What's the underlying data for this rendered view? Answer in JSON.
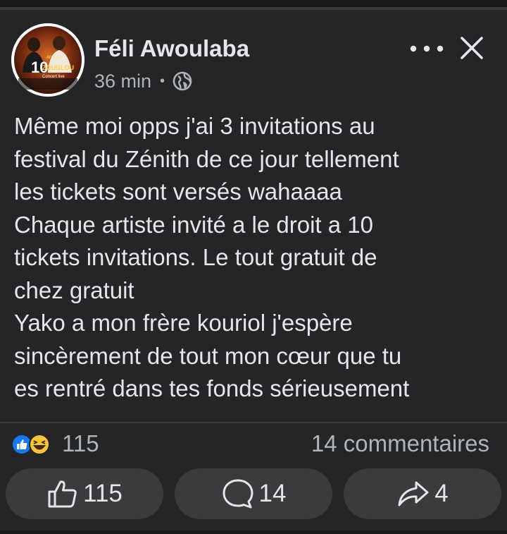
{
  "post": {
    "author": "Féli Awoulaba",
    "time": "36 min",
    "separator": "•",
    "privacy_icon": "globe-icon",
    "avatar_text": {
      "line1": "ANS de",
      "line2": "10",
      "line3": "ZOUGLOU",
      "line4": "Concert live"
    },
    "text_lines": [
      "Même moi opps j'ai 3 invitations au",
      "festival du Zénith de ce jour tellement",
      "les tickets sont versés wahaaaa",
      "Chaque artiste invité a le droit a 10",
      "tickets invitations. Le tout gratuit de",
      "chez gratuit",
      "Yako a mon frère kouriol j'espère",
      "sincèrement de tout mon cœur que tu",
      "es rentré dans tes fonds sérieusement"
    ]
  },
  "stats": {
    "reactions_count": "115",
    "reaction_icons": [
      "like-icon",
      "laugh-emoji-icon"
    ],
    "comments_label": "14 commentaires"
  },
  "actions": {
    "like_count": "115",
    "comment_count": "14",
    "share_count": "4"
  },
  "colors": {
    "background": "#242526",
    "button_bg": "#3a3b3c",
    "text_primary": "#e4e6eb",
    "text_secondary": "#b0b3b8",
    "like_blue": "#1877f2",
    "emoji_yellow": "#f7c53a"
  }
}
